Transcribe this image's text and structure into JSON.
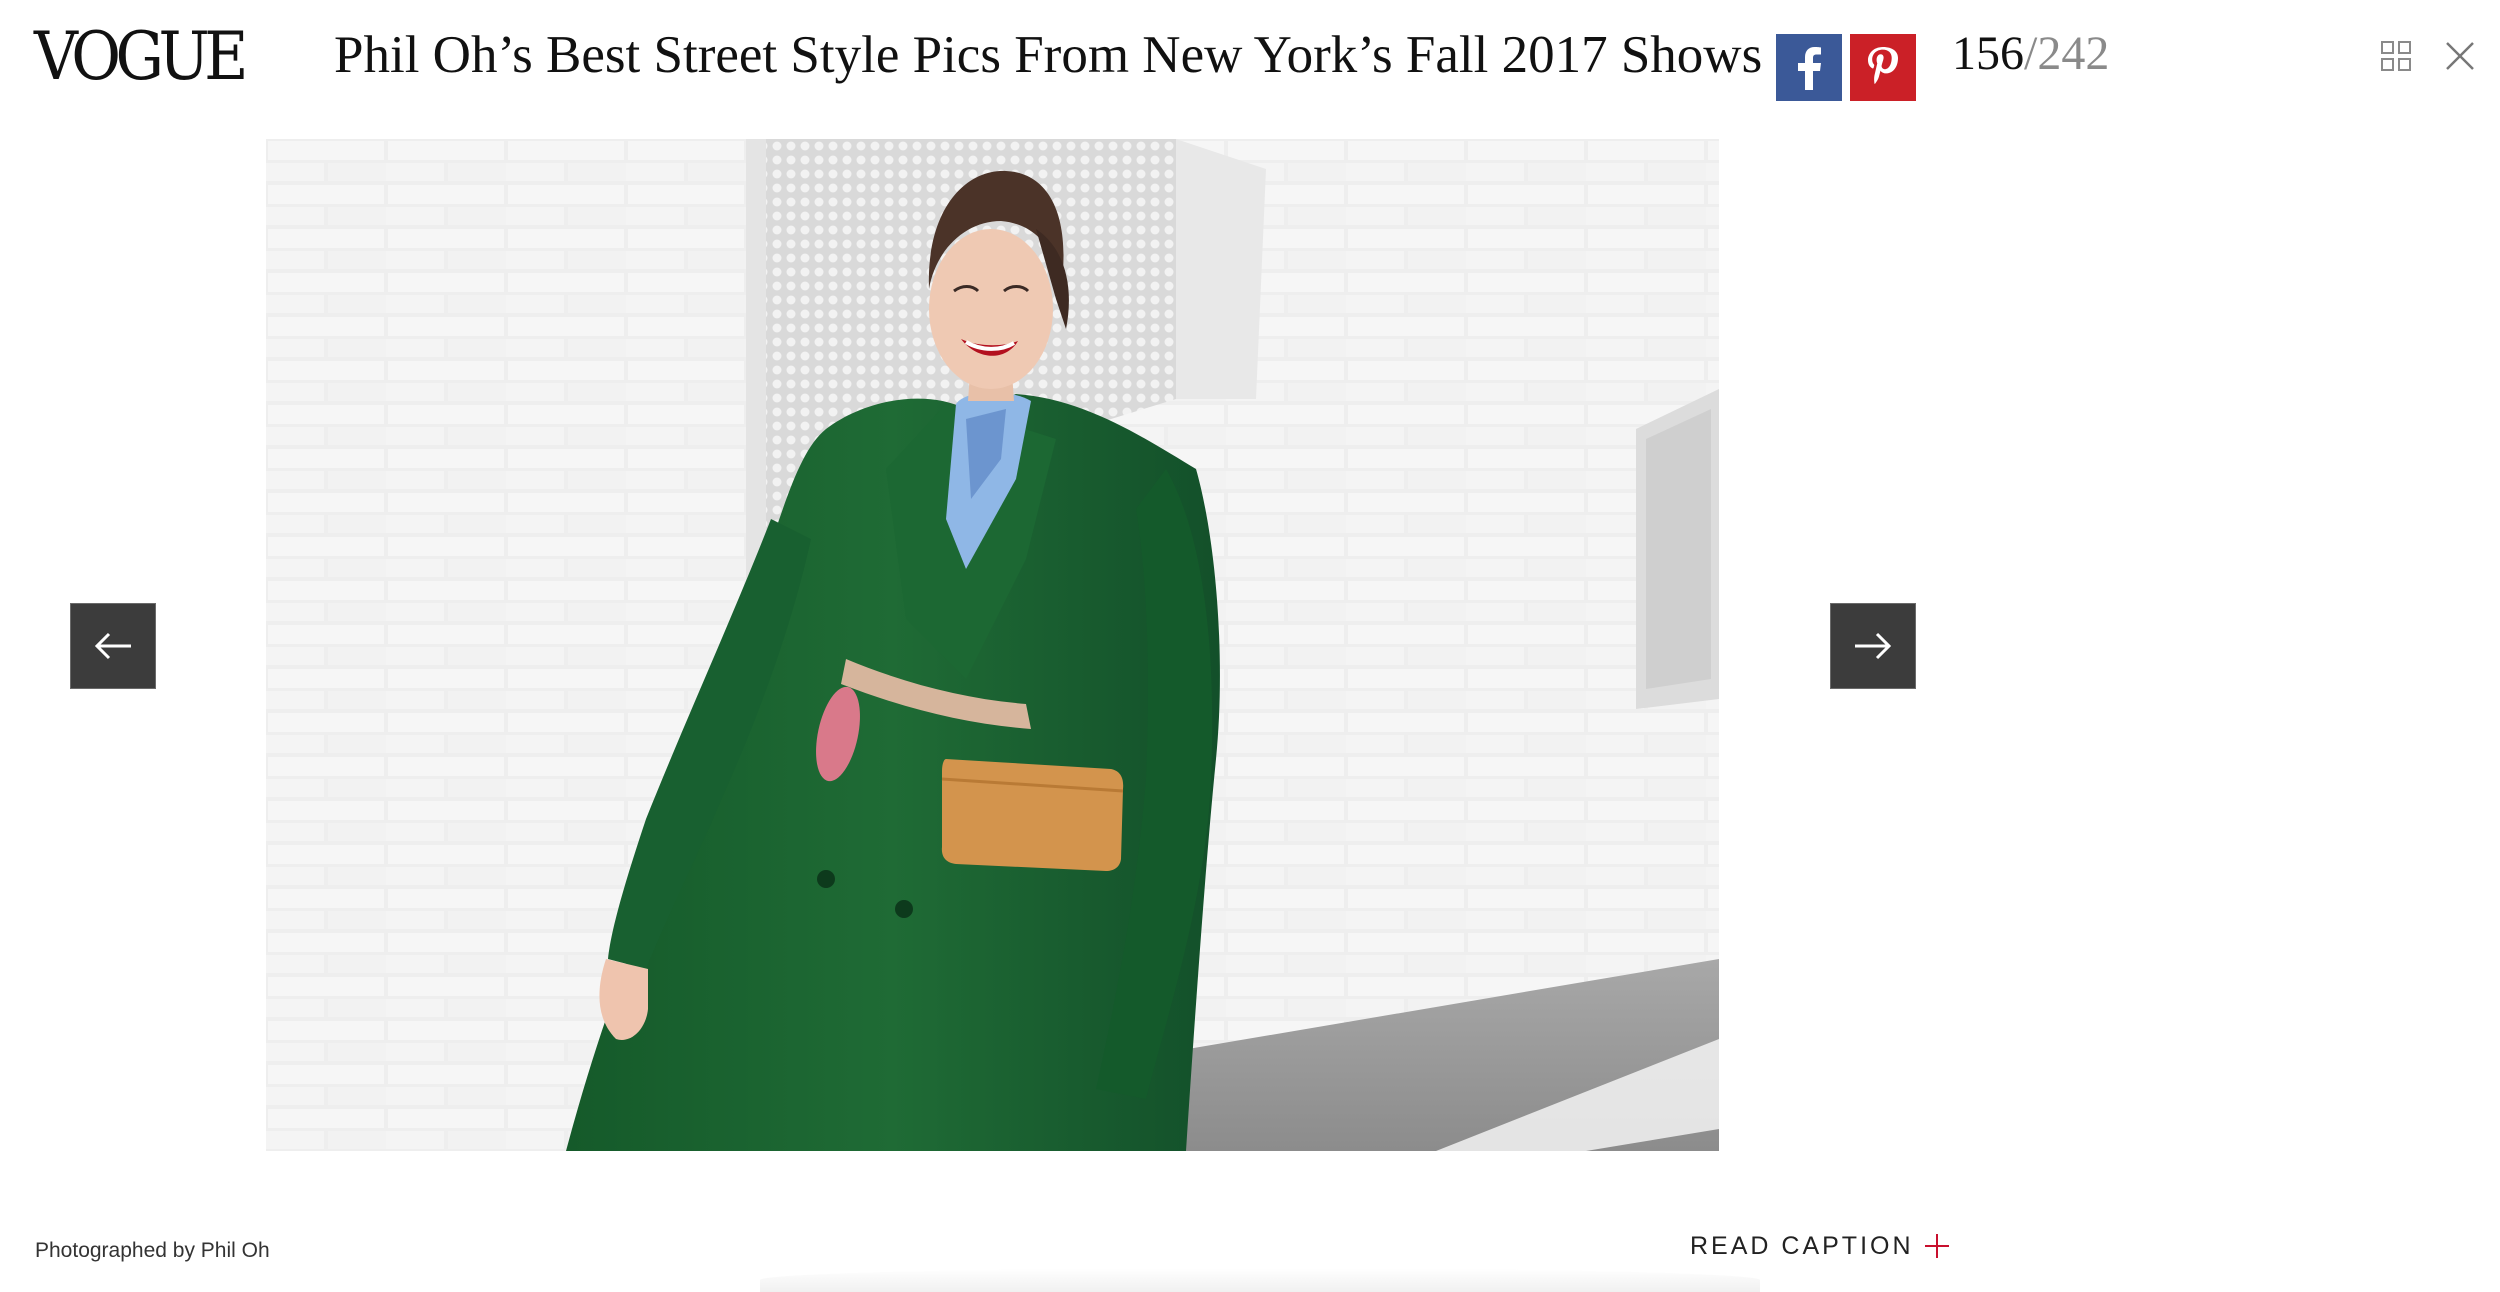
{
  "header": {
    "logo": "VOGUE",
    "title": "Phil Oh’s Best Street Style Pics From New York’s Fall 2017 Shows",
    "share": {
      "facebook_icon": "facebook-icon",
      "pinterest_icon": "pinterest-icon"
    },
    "counter": {
      "current": "156",
      "separator": "/",
      "total": "242"
    },
    "tools": {
      "grid_icon": "grid-view-icon",
      "close_icon": "close-icon"
    }
  },
  "slide": {
    "image_icon": "street-style-photo",
    "prev_icon": "arrow-left-icon",
    "next_icon": "arrow-right-icon"
  },
  "footer": {
    "credit": "Photographed by Phil Oh",
    "read_caption": "READ CAPTION",
    "read_caption_icon": "plus-icon"
  },
  "colors": {
    "facebook": "#3b5998",
    "pinterest": "#cb2027",
    "accent_plus": "#c8102e",
    "arrow_bg": "#3c3c3c",
    "coat_green": "#1f6b35"
  }
}
